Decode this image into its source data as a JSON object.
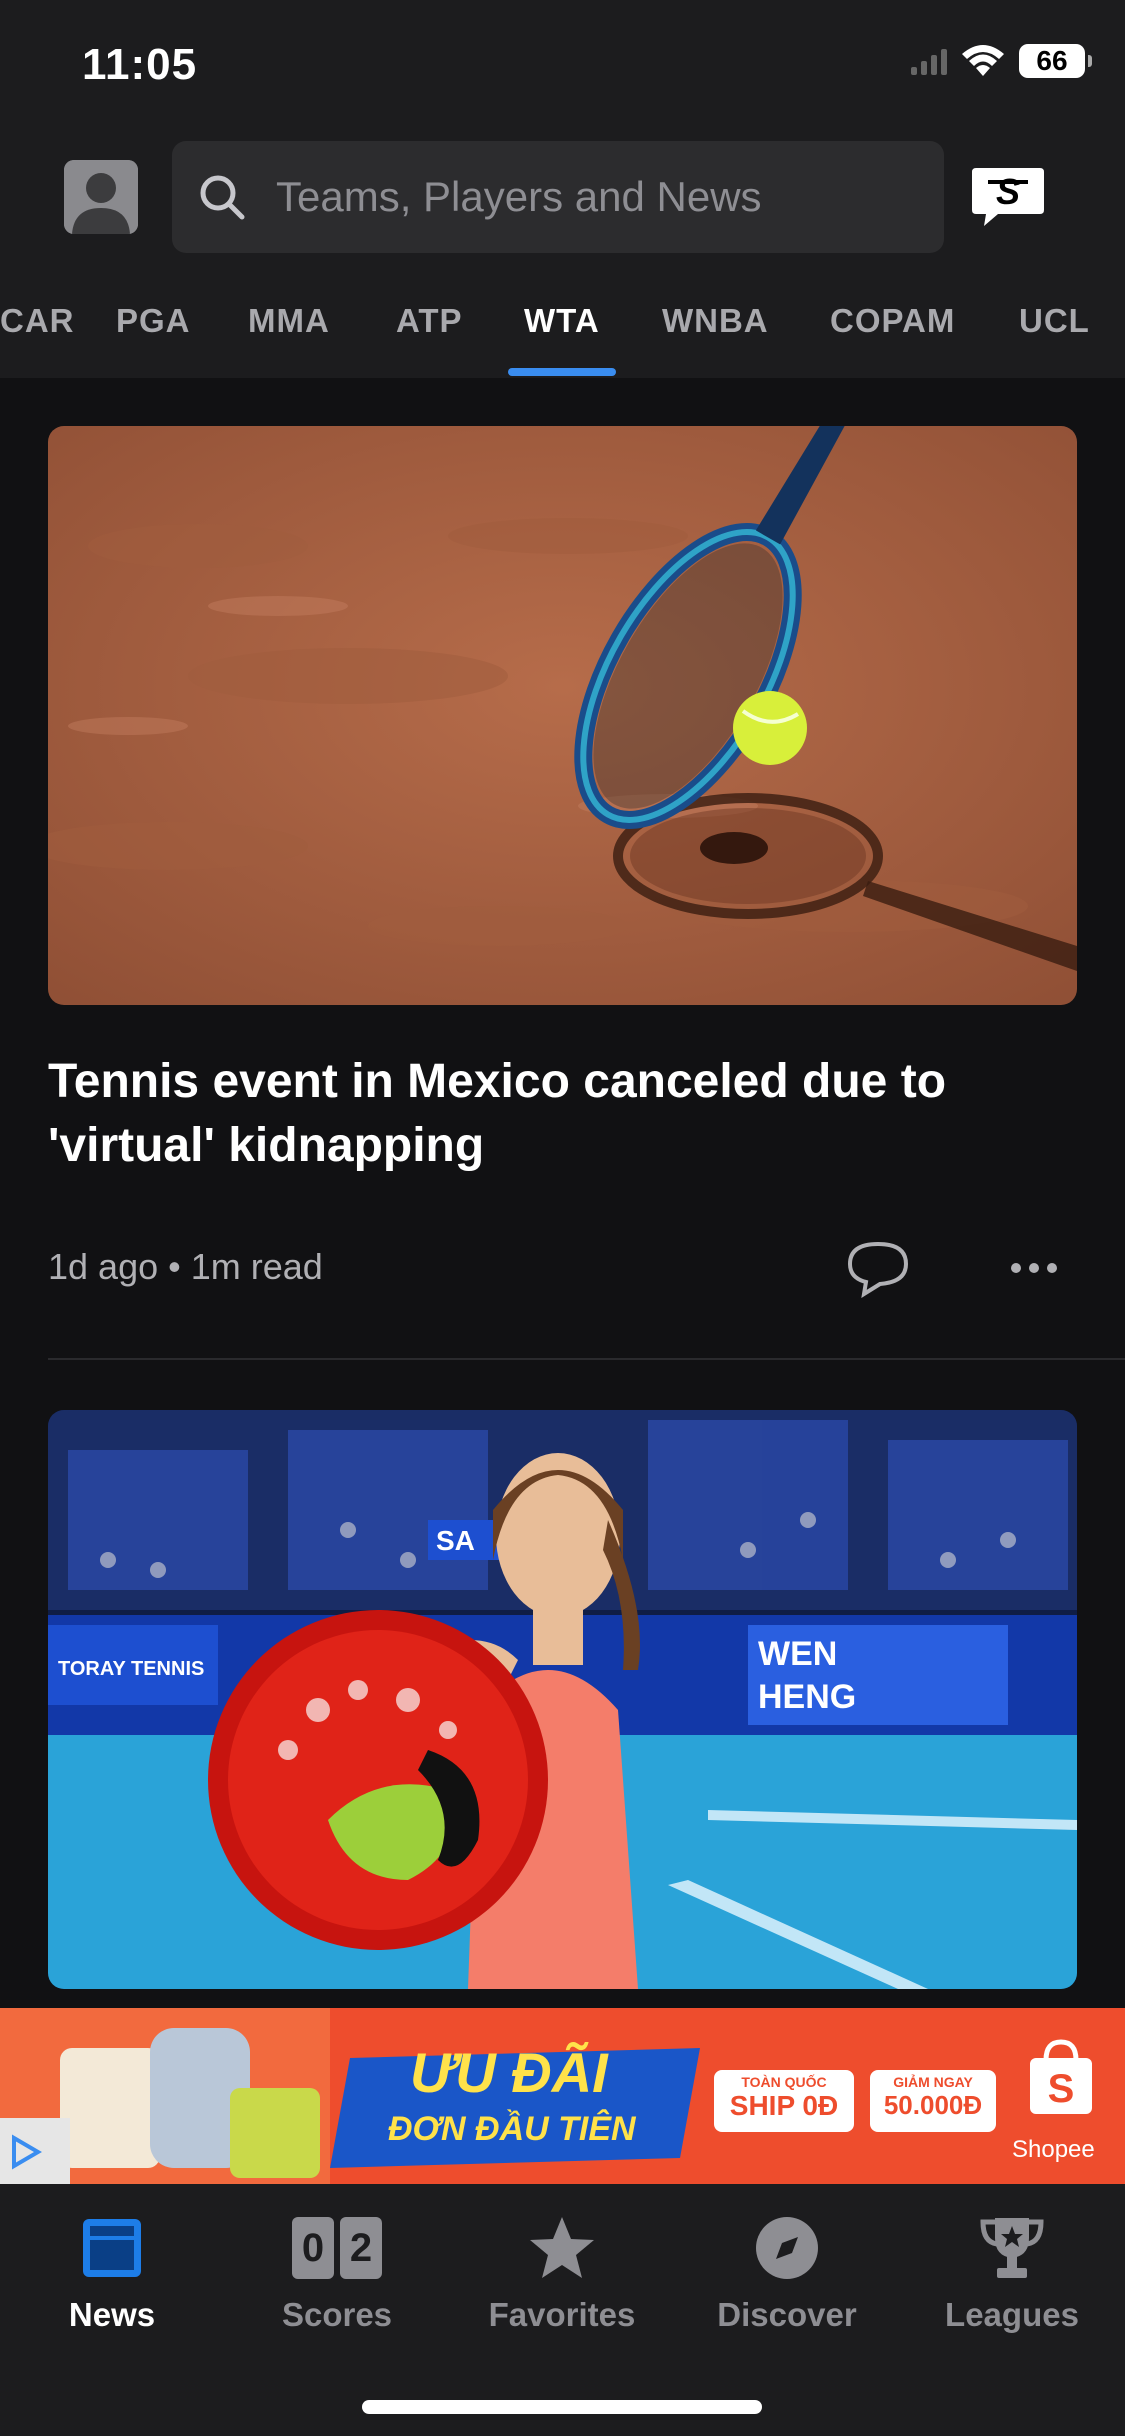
{
  "status_bar": {
    "time": "11:05",
    "battery": "66"
  },
  "search": {
    "placeholder": "Teams, Players and News"
  },
  "tabs": [
    {
      "label": "CAR"
    },
    {
      "label": "PGA"
    },
    {
      "label": "MMA"
    },
    {
      "label": "ATP"
    },
    {
      "label": "WTA",
      "active": true
    },
    {
      "label": "WNBA"
    },
    {
      "label": "COPAM"
    },
    {
      "label": "UCL"
    }
  ],
  "articles": [
    {
      "headline": "Tennis event in Mexico canceled due to 'virtual' kidnapping",
      "age": "1d ago",
      "read_time": "1m read"
    }
  ],
  "second_article_image_text": {
    "banner_left": "TORAY TENNIS",
    "banner_right": "WEN\nHENG",
    "sponsor": "SA"
  },
  "ad": {
    "headline": "ƯU ĐÃI",
    "subline": "ĐƠN ĐẦU TIÊN",
    "tag1_top": "TOÀN QUỐC",
    "tag1_main": "SHIP 0Đ",
    "tag2_top": "GIẢM NGAY",
    "tag2_main": "50.000Đ",
    "brand": "Shopee"
  },
  "bottom_nav": [
    {
      "label": "News",
      "icon": "news-icon",
      "active": true
    },
    {
      "label": "Scores",
      "icon": "scores-icon",
      "score_left": "0",
      "score_right": "2"
    },
    {
      "label": "Favorites",
      "icon": "star-icon"
    },
    {
      "label": "Discover",
      "icon": "compass-icon"
    },
    {
      "label": "Leagues",
      "icon": "trophy-icon"
    }
  ],
  "colors": {
    "accent": "#3a8df0",
    "ad_orange": "#ee4d2d"
  }
}
